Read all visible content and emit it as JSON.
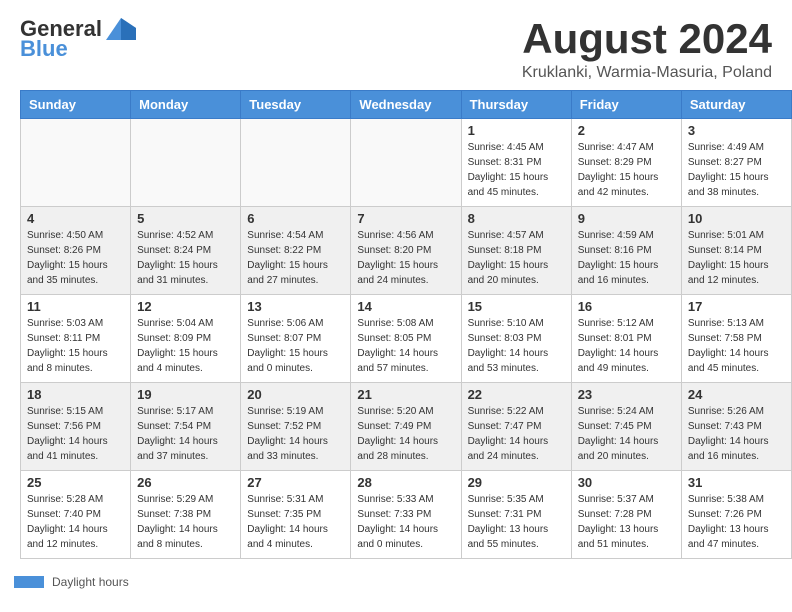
{
  "header": {
    "logo_general": "General",
    "logo_blue": "Blue",
    "month_title": "August 2024",
    "location": "Kruklanki, Warmia-Masuria, Poland"
  },
  "days_of_week": [
    "Sunday",
    "Monday",
    "Tuesday",
    "Wednesday",
    "Thursday",
    "Friday",
    "Saturday"
  ],
  "weeks": [
    [
      {
        "day": "",
        "info": ""
      },
      {
        "day": "",
        "info": ""
      },
      {
        "day": "",
        "info": ""
      },
      {
        "day": "",
        "info": ""
      },
      {
        "day": "1",
        "info": "Sunrise: 4:45 AM\nSunset: 8:31 PM\nDaylight: 15 hours\nand 45 minutes."
      },
      {
        "day": "2",
        "info": "Sunrise: 4:47 AM\nSunset: 8:29 PM\nDaylight: 15 hours\nand 42 minutes."
      },
      {
        "day": "3",
        "info": "Sunrise: 4:49 AM\nSunset: 8:27 PM\nDaylight: 15 hours\nand 38 minutes."
      }
    ],
    [
      {
        "day": "4",
        "info": "Sunrise: 4:50 AM\nSunset: 8:26 PM\nDaylight: 15 hours\nand 35 minutes."
      },
      {
        "day": "5",
        "info": "Sunrise: 4:52 AM\nSunset: 8:24 PM\nDaylight: 15 hours\nand 31 minutes."
      },
      {
        "day": "6",
        "info": "Sunrise: 4:54 AM\nSunset: 8:22 PM\nDaylight: 15 hours\nand 27 minutes."
      },
      {
        "day": "7",
        "info": "Sunrise: 4:56 AM\nSunset: 8:20 PM\nDaylight: 15 hours\nand 24 minutes."
      },
      {
        "day": "8",
        "info": "Sunrise: 4:57 AM\nSunset: 8:18 PM\nDaylight: 15 hours\nand 20 minutes."
      },
      {
        "day": "9",
        "info": "Sunrise: 4:59 AM\nSunset: 8:16 PM\nDaylight: 15 hours\nand 16 minutes."
      },
      {
        "day": "10",
        "info": "Sunrise: 5:01 AM\nSunset: 8:14 PM\nDaylight: 15 hours\nand 12 minutes."
      }
    ],
    [
      {
        "day": "11",
        "info": "Sunrise: 5:03 AM\nSunset: 8:11 PM\nDaylight: 15 hours\nand 8 minutes."
      },
      {
        "day": "12",
        "info": "Sunrise: 5:04 AM\nSunset: 8:09 PM\nDaylight: 15 hours\nand 4 minutes."
      },
      {
        "day": "13",
        "info": "Sunrise: 5:06 AM\nSunset: 8:07 PM\nDaylight: 15 hours\nand 0 minutes."
      },
      {
        "day": "14",
        "info": "Sunrise: 5:08 AM\nSunset: 8:05 PM\nDaylight: 14 hours\nand 57 minutes."
      },
      {
        "day": "15",
        "info": "Sunrise: 5:10 AM\nSunset: 8:03 PM\nDaylight: 14 hours\nand 53 minutes."
      },
      {
        "day": "16",
        "info": "Sunrise: 5:12 AM\nSunset: 8:01 PM\nDaylight: 14 hours\nand 49 minutes."
      },
      {
        "day": "17",
        "info": "Sunrise: 5:13 AM\nSunset: 7:58 PM\nDaylight: 14 hours\nand 45 minutes."
      }
    ],
    [
      {
        "day": "18",
        "info": "Sunrise: 5:15 AM\nSunset: 7:56 PM\nDaylight: 14 hours\nand 41 minutes."
      },
      {
        "day": "19",
        "info": "Sunrise: 5:17 AM\nSunset: 7:54 PM\nDaylight: 14 hours\nand 37 minutes."
      },
      {
        "day": "20",
        "info": "Sunrise: 5:19 AM\nSunset: 7:52 PM\nDaylight: 14 hours\nand 33 minutes."
      },
      {
        "day": "21",
        "info": "Sunrise: 5:20 AM\nSunset: 7:49 PM\nDaylight: 14 hours\nand 28 minutes."
      },
      {
        "day": "22",
        "info": "Sunrise: 5:22 AM\nSunset: 7:47 PM\nDaylight: 14 hours\nand 24 minutes."
      },
      {
        "day": "23",
        "info": "Sunrise: 5:24 AM\nSunset: 7:45 PM\nDaylight: 14 hours\nand 20 minutes."
      },
      {
        "day": "24",
        "info": "Sunrise: 5:26 AM\nSunset: 7:43 PM\nDaylight: 14 hours\nand 16 minutes."
      }
    ],
    [
      {
        "day": "25",
        "info": "Sunrise: 5:28 AM\nSunset: 7:40 PM\nDaylight: 14 hours\nand 12 minutes."
      },
      {
        "day": "26",
        "info": "Sunrise: 5:29 AM\nSunset: 7:38 PM\nDaylight: 14 hours\nand 8 minutes."
      },
      {
        "day": "27",
        "info": "Sunrise: 5:31 AM\nSunset: 7:35 PM\nDaylight: 14 hours\nand 4 minutes."
      },
      {
        "day": "28",
        "info": "Sunrise: 5:33 AM\nSunset: 7:33 PM\nDaylight: 14 hours\nand 0 minutes."
      },
      {
        "day": "29",
        "info": "Sunrise: 5:35 AM\nSunset: 7:31 PM\nDaylight: 13 hours\nand 55 minutes."
      },
      {
        "day": "30",
        "info": "Sunrise: 5:37 AM\nSunset: 7:28 PM\nDaylight: 13 hours\nand 51 minutes."
      },
      {
        "day": "31",
        "info": "Sunrise: 5:38 AM\nSunset: 7:26 PM\nDaylight: 13 hours\nand 47 minutes."
      }
    ]
  ],
  "legend": {
    "label": "Daylight hours"
  }
}
